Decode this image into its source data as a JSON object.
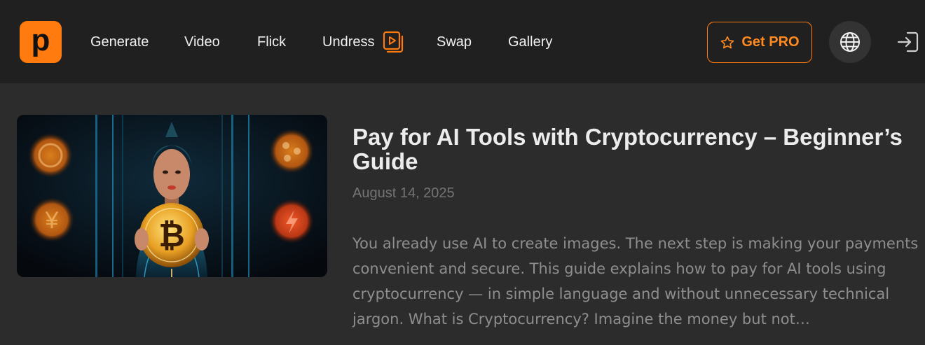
{
  "header": {
    "logo_letter": "p",
    "nav": [
      {
        "label": "Generate"
      },
      {
        "label": "Video"
      },
      {
        "label": "Flick"
      },
      {
        "label": "Undress"
      },
      {
        "label": "Swap"
      },
      {
        "label": "Gallery"
      }
    ],
    "get_pro_label": "Get PRO"
  },
  "article": {
    "title": "Pay for AI Tools with Cryptocurrency – Beginner’s Guide",
    "date": "August 14, 2025",
    "excerpt": "You already use AI to create images. The next step is making your payments convenient and secure. This guide explains how to pay for AI tools using cryptocurrency — in simple language and without unnecessary technical jargon. What is Cryptocurrency? Imagine the money but not…",
    "thumbnail_coin_symbols": [
      "₿",
      "¥"
    ]
  },
  "colors": {
    "accent": "#ff7b0f",
    "header_bg": "#202020",
    "page_bg": "#2c2c2c"
  },
  "icons": {
    "logo": "logo-icon",
    "video": "video-play-icon",
    "star": "star-icon",
    "globe": "globe-icon",
    "login": "login-icon"
  }
}
